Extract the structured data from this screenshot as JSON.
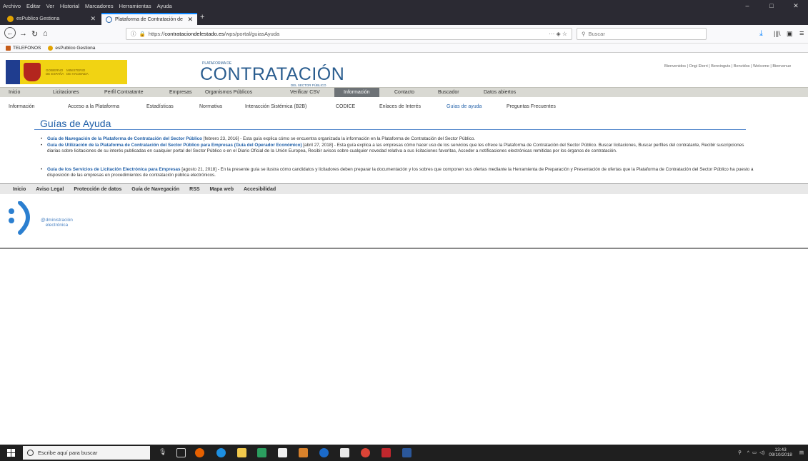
{
  "browser": {
    "menu": [
      "Archivo",
      "Editar",
      "Ver",
      "Historial",
      "Marcadores",
      "Herramientas",
      "Ayuda"
    ],
    "tabs": [
      {
        "label": "esPublico Gestiona",
        "active": false
      },
      {
        "label": "Plataforma de Contratación de",
        "active": true
      }
    ],
    "url_prefix": "https://",
    "url_host": "contrataciondelestado.es",
    "url_path": "/wps/portal/guiasAyuda",
    "search_placeholder": "Buscar",
    "bookmarks": [
      {
        "label": "TELEFONOS",
        "color": "#c65c1a"
      },
      {
        "label": "esPublico Gestiona",
        "color": "#e2a300"
      }
    ]
  },
  "header": {
    "gov_line1": "GOBIERNO\nDE ESPAÑA",
    "gov_line2": "MINISTERIO\nDE HACIENDA",
    "brand_sup": "PLATAFORMA DE",
    "brand_main": "CONTRATACIÓN",
    "brand_sub": "DEL SECTOR PÚBLICO",
    "welcome": "Bienvenidos | Ongi Etorri | Benvinguts | Benvidos | Welcome | Bienvenue"
  },
  "main_menu": [
    "Inicio",
    "Licitaciones",
    "Perfil Contratante",
    "Empresas",
    "Organismos Públicos",
    "Verificar CSV",
    "Información",
    "Contacto",
    "Buscador",
    "Datos abiertos"
  ],
  "main_menu_active": "Información",
  "sub_menu": [
    "Información",
    "Acceso a la Plataforma",
    "Estadísticas",
    "Normativa",
    "Interacción Sistémica (B2B)",
    "CODICE",
    "Enlaces de Interés",
    "Guías de ayuda",
    "Preguntas Frecuentes"
  ],
  "sub_menu_active": "Guías de ayuda",
  "page": {
    "title": "Guías de Ayuda",
    "guides": [
      {
        "link": "Guía de Navegación de la Plataforma de Contratación del Sector Público",
        "text": " [febrero 23, 2016] - Esta guía explica cómo se encuentra organizada la información en la Plataforma de Contratación del Sector Público."
      },
      {
        "link": "Guía de Utilización de la Plataforma de Contratación del Sector Público para Empresas (Guía del Operador Económico)",
        "text": " [abril 27, 2018] - Esta guía explica a las empresas cómo hacer uso de los servicios que les ofrece la Plataforma de Contratación del Sector Público. Buscar licitaciones, Buscar perfiles del contratante, Recibir suscripciones diarias sobre licitaciones de su interés publicadas en cualquier portal del Sector Público o en el Diario Oficial de la Unión Europea, Recibir avisos sobre cualquier novedad relativa a sus licitaciones favoritas, Acceder a notificaciones electrónicas remitidas por los órganos de contratación."
      },
      {
        "link": "Guía de los Servicios de Licitación Electrónica para Empresas",
        "text": " [agosto 21, 2018] - En la presente guía se ilustra cómo candidatos y licitadores deben preparar la documentación y los sobres que componen sus ofertas mediante la Herramienta de Preparación y Presentación de ofertas que la Plataforma de Contratación del Sector Público ha puesto a disposición de las empresas en procedimientos de contratación pública electrónicos."
      }
    ]
  },
  "footer": {
    "links": [
      "Inicio",
      "Aviso Legal",
      "Protección de datos",
      "Guía de Navegación",
      "RSS",
      "Mapa web",
      "Accesibilidad"
    ],
    "ae_line1": "@dministración",
    "ae_line2": "electrónica"
  },
  "taskbar": {
    "search_placeholder": "Escribe aquí para buscar",
    "time": "13:43",
    "date": "09/10/2018"
  }
}
